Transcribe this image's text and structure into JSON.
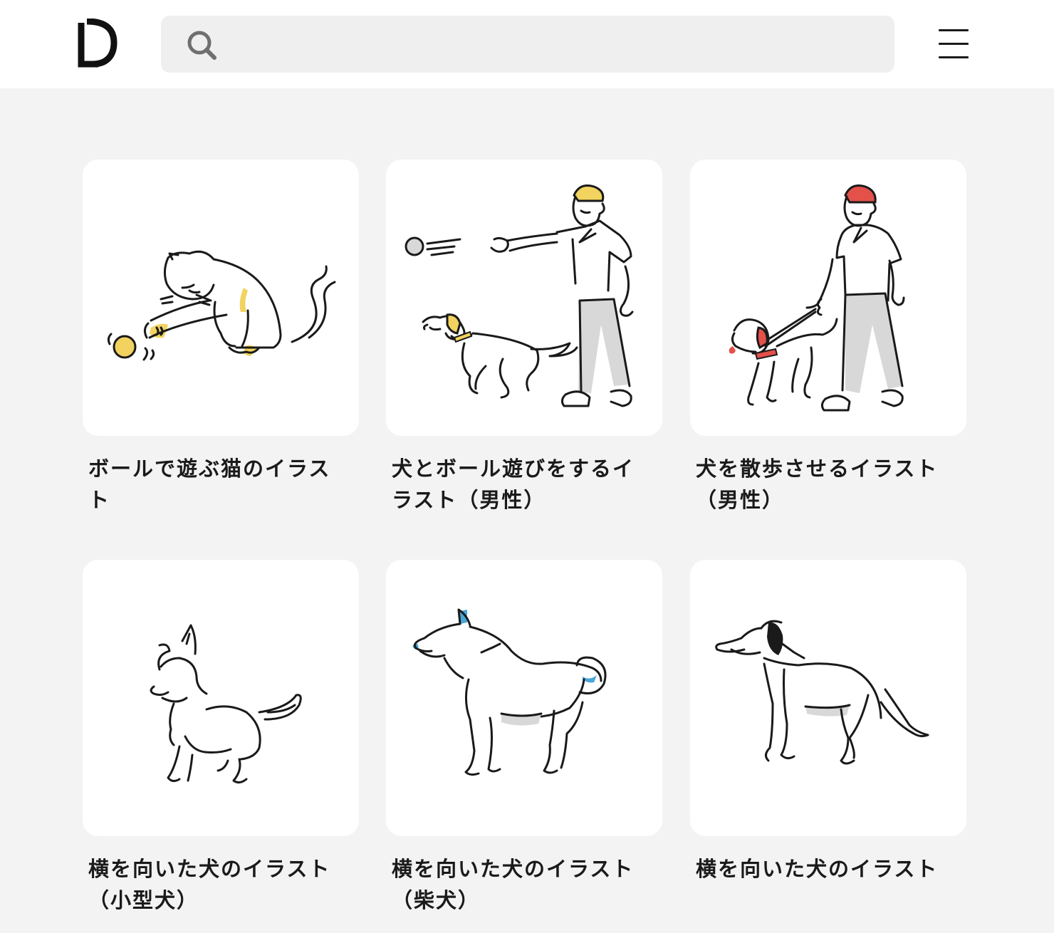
{
  "header": {
    "logo_alt": "D",
    "search": {
      "placeholder": "",
      "value": ""
    },
    "icons": {
      "search": "search-icon",
      "menu": "hamburger-menu-icon"
    }
  },
  "accent_colors": {
    "yellow": "#f2d35f",
    "red": "#e4504a",
    "gray_fill": "#d8d8d8",
    "blue": "#4aa6d8"
  },
  "cards": [
    {
      "title": "ボールで遊ぶ猫のイラスト",
      "illustration": "cat-playing-ball"
    },
    {
      "title": "犬とボール遊びをするイラスト（男性）",
      "illustration": "man-throwing-ball-to-dog"
    },
    {
      "title": "犬を散歩させるイラスト（男性）",
      "illustration": "man-walking-dog"
    },
    {
      "title": "横を向いた犬のイラスト（小型犬）",
      "illustration": "small-dog-side"
    },
    {
      "title": "横を向いた犬のイラスト（柴犬）",
      "illustration": "shiba-dog-side"
    },
    {
      "title": "横を向いた犬のイラスト",
      "illustration": "dog-side"
    }
  ]
}
